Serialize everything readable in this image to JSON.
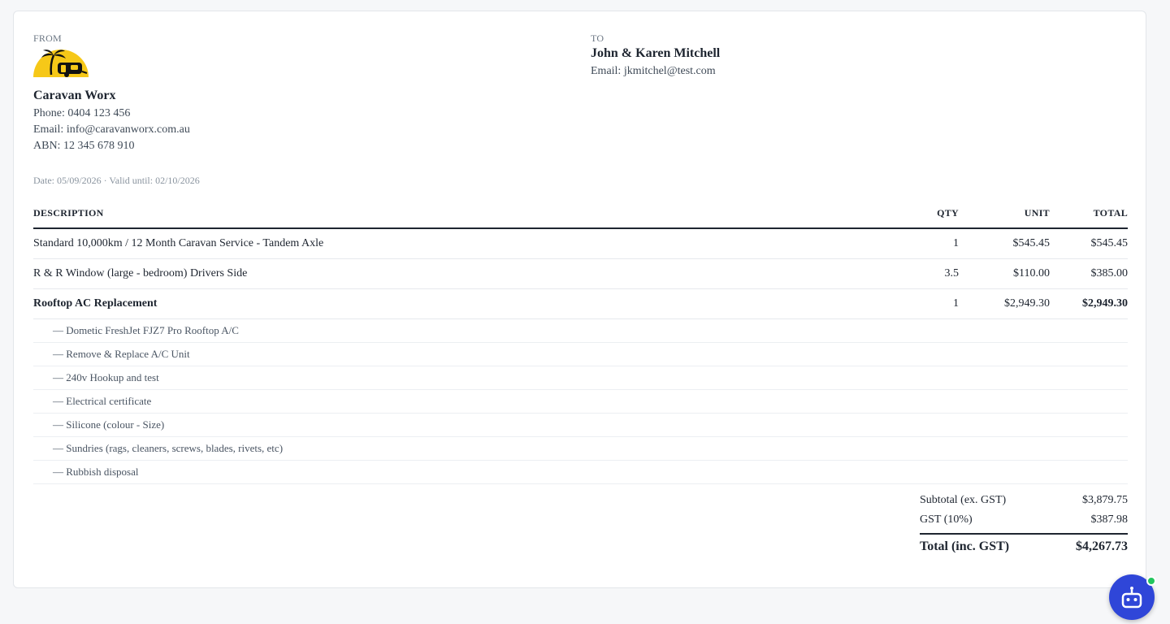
{
  "from": {
    "label": "FROM",
    "business_name": "Caravan Worx",
    "phone": "Phone: 0404 123 456",
    "email": "Email: info@caravanworx.com.au",
    "abn": "ABN: 12 345 678 910"
  },
  "to": {
    "label": "TO",
    "client_name": "John & Karen Mitchell",
    "email": "Email: jkmitchel@test.com"
  },
  "dateline": "Date: 05/09/2026 · Valid until: 02/10/2026",
  "columns": {
    "description": "DESCRIPTION",
    "qty": "QTY",
    "unit": "UNIT",
    "total": "TOTAL"
  },
  "items": [
    {
      "description": "Standard 10,000km / 12 Month Caravan Service - Tandem Axle",
      "qty": "1",
      "unit": "$545.45",
      "total": "$545.45"
    },
    {
      "description": "R & R Window (large - bedroom) Drivers Side",
      "qty": "3.5",
      "unit": "$110.00",
      "total": "$385.00"
    },
    {
      "description": "Rooftop AC Replacement",
      "qty": "1",
      "unit": "$2,949.30",
      "total": "$2,949.30"
    }
  ],
  "sub_items": [
    "— Dometic FreshJet FJZ7 Pro Rooftop A/C",
    "— Remove & Replace A/C Unit",
    "— 240v Hookup and test",
    "— Electrical certificate",
    "— Silicone (colour - Size)",
    "— Sundries (rags, cleaners, screws, blades, rivets, etc)",
    "— Rubbish disposal"
  ],
  "totals": {
    "subtotal_label": "Subtotal (ex. GST)",
    "subtotal_value": "$3,879.75",
    "gst_label": "GST (10%)",
    "gst_value": "$387.98",
    "total_label": "Total (inc. GST)",
    "total_value": "$4,267.73"
  },
  "colors": {
    "logo_yellow": "#f6c818",
    "chat_button": "#2f46d8",
    "online_dot": "#22c55e"
  },
  "icons": {
    "logo": "palm-tree-caravan-logo",
    "chat": "robot-chat-icon"
  }
}
